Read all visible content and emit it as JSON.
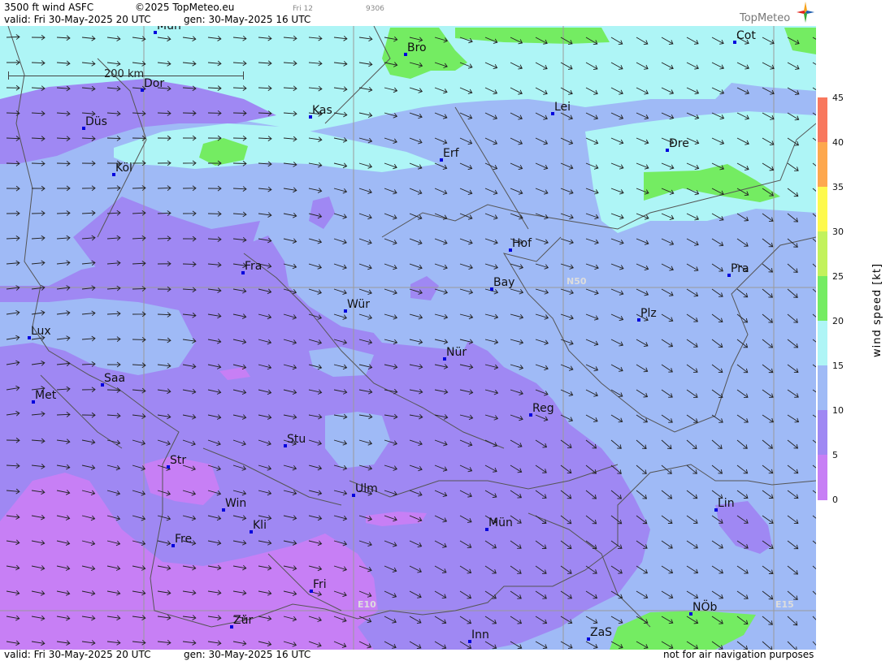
{
  "header": {
    "product": "3500 ft wind ASFC",
    "copyright": "©2025 TopMeteo.eu",
    "frame_day": "Fri 12",
    "frame_code": "9306",
    "valid_line": "valid:  Fri  30-May-2025  20 UTC",
    "gen_line": "gen: 30-May-2025 16 UTC",
    "logo": "TopMeteo"
  },
  "footer": {
    "valid_line": "valid:  Fri  30-May-2025  20 UTC",
    "gen_line": "gen: 30-May-2025 16 UTC",
    "notice": "not for air navigation purposes"
  },
  "scale_bar": {
    "label": "200 km"
  },
  "grid_labels": {
    "n50": "N50",
    "e10": "E10",
    "e15": "E15"
  },
  "cities": [
    {
      "name": "Mün",
      "id": "top-mun"
    },
    {
      "name": "Bro"
    },
    {
      "name": "Cot"
    },
    {
      "name": "Dor"
    },
    {
      "name": "Kas"
    },
    {
      "name": "Lei"
    },
    {
      "name": "Düs"
    },
    {
      "name": "Erf"
    },
    {
      "name": "Dre"
    },
    {
      "name": "Köl"
    },
    {
      "name": "Hof"
    },
    {
      "name": "Fra"
    },
    {
      "name": "Pra"
    },
    {
      "name": "Bay"
    },
    {
      "name": "Wür"
    },
    {
      "name": "Plz"
    },
    {
      "name": "Lux"
    },
    {
      "name": "Nür"
    },
    {
      "name": "Saa"
    },
    {
      "name": "Met"
    },
    {
      "name": "Reg"
    },
    {
      "name": "Stu"
    },
    {
      "name": "Str"
    },
    {
      "name": "Ulm"
    },
    {
      "name": "Win"
    },
    {
      "name": "Lin"
    },
    {
      "name": "Kli"
    },
    {
      "name": "Mün"
    },
    {
      "name": "Fre"
    },
    {
      "name": "Fri"
    },
    {
      "name": "NÖb"
    },
    {
      "name": "Zür"
    },
    {
      "name": "ZaS"
    },
    {
      "name": "Inn"
    }
  ],
  "legend": {
    "title": "wind speed [kt]",
    "ticks": [
      "45",
      "40",
      "35",
      "30",
      "25",
      "20",
      "15",
      "10",
      "5",
      "0"
    ],
    "colors": {
      "0-5": "#c77ff5",
      "5-10": "#9f88f3",
      "10-15": "#9fbaf6",
      "15-20": "#aef5f6",
      "20-25": "#74ec62",
      "25-30": "#c2f25c",
      "30-35": "#fdf94d",
      "35-40": "#fda84e",
      "40-45": "#f8785e"
    }
  }
}
